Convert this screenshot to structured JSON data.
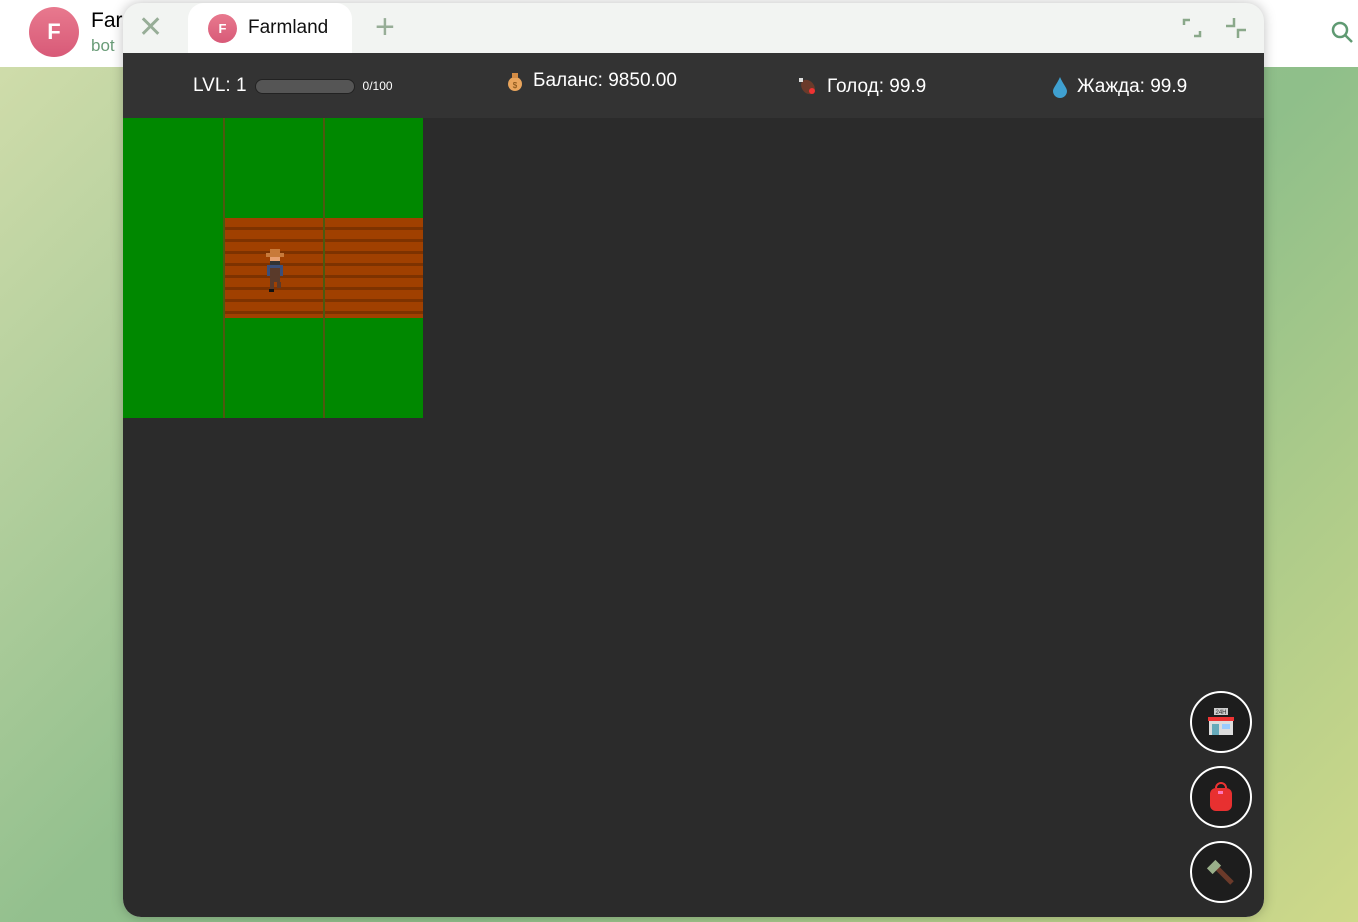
{
  "chat": {
    "avatar_letter": "F",
    "title": "Far",
    "subtitle": "bot"
  },
  "window": {
    "tab": {
      "avatar_letter": "F",
      "label": "Farmland"
    }
  },
  "hud": {
    "level_label": "LVL: 1",
    "xp_text": "0/100",
    "xp_progress": 0,
    "balance": "Баланс: 9850.00",
    "hunger": "Голод: 99.9",
    "thirst": "Жажда: 99.9"
  },
  "field": {
    "tiles": [
      [
        "grass",
        "grass",
        "grass"
      ],
      [
        "grass",
        "soil",
        "soil"
      ],
      [
        "grass",
        "grass",
        "grass"
      ]
    ],
    "colors": {
      "grass": "#008800",
      "soil": "#a04000"
    }
  },
  "actions": [
    {
      "name": "shop",
      "icon": "convenience-store-icon"
    },
    {
      "name": "inventory",
      "icon": "backpack-icon"
    },
    {
      "name": "build",
      "icon": "hammer-icon"
    }
  ]
}
